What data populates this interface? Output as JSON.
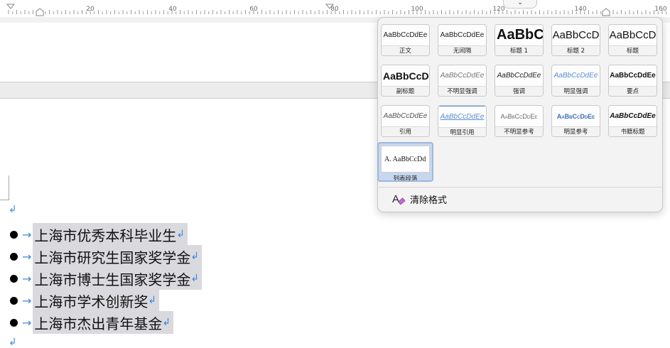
{
  "ruler": {
    "numbers": [
      "20",
      "40",
      "60",
      "80",
      "100",
      "120",
      "140",
      "160"
    ]
  },
  "document": {
    "list_items": [
      "上海市优秀本科毕业生",
      "上海市研究生国家奖学金",
      "上海市博士生国家奖学金",
      "上海市学术创新奖",
      "上海市杰出青年基金"
    ],
    "paragraph_mark": "↲",
    "tab_arrow": "→"
  },
  "style_gallery": {
    "collapse_icon": "⌄",
    "styles": [
      {
        "preview": "AaBbCcDdEe",
        "name": "正文"
      },
      {
        "preview": "AaBbCcDdEe",
        "name": "无间隔"
      },
      {
        "preview": "AaBbC",
        "name": "标题 1"
      },
      {
        "preview": "AaBbCcD",
        "name": "标题 2"
      },
      {
        "preview": "AaBbCcD",
        "name": "标题"
      },
      {
        "preview": "AaBbCcDI",
        "name": "副标题"
      },
      {
        "preview": "AaBbCcDdEe",
        "name": "不明显强调"
      },
      {
        "preview": "AaBbCcDdEe",
        "name": "强调"
      },
      {
        "preview": "AaBbCcDdEe",
        "name": "明显强调"
      },
      {
        "preview": "AaBbCcDdEe",
        "name": "要点"
      },
      {
        "preview": "AaBbCcDdEe",
        "name": "引用"
      },
      {
        "preview": "AaBbCcDdEe",
        "name": "明显引用"
      },
      {
        "preview": "AaBbCcDdEe",
        "name": "不明显参考"
      },
      {
        "preview": "AaBbCcDdEe",
        "name": "明显参考"
      },
      {
        "preview": "AaBbCcDdEe",
        "name": "书籍标题"
      },
      {
        "preview": "A.  AaBbCcDd",
        "name": "列表段落"
      }
    ],
    "clear_format_label": "清除格式",
    "accent_color": "#3d87d9",
    "link_style_color": "#3b6fb6"
  }
}
